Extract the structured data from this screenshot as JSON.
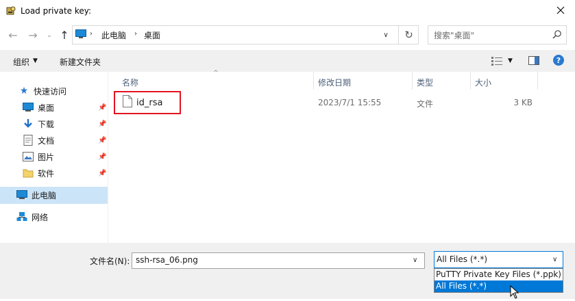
{
  "window": {
    "title": "Load private key:"
  },
  "address": {
    "path": [
      "此电脑",
      "桌面"
    ]
  },
  "search": {
    "placeholder": "搜索\"桌面\""
  },
  "toolbar": {
    "organize_label": "组织",
    "new_folder_label": "新建文件夹"
  },
  "sidebar": {
    "quick_access": "快速访问",
    "pinned": [
      {
        "label": "桌面",
        "icon": "desktop-icon"
      },
      {
        "label": "下载",
        "icon": "download-icon"
      },
      {
        "label": "文档",
        "icon": "document-icon"
      },
      {
        "label": "图片",
        "icon": "pictures-icon"
      },
      {
        "label": "软件",
        "icon": "folder-icon"
      }
    ],
    "this_pc": "此电脑",
    "network": "网络"
  },
  "columns": {
    "name": "名称",
    "modified": "修改日期",
    "type": "类型",
    "size": "大小"
  },
  "files": [
    {
      "name": "id_rsa",
      "modified": "2023/7/1 15:55",
      "type": "文件",
      "size": "3 KB"
    }
  ],
  "bottom": {
    "filename_label": "文件名(N):",
    "filename_value": "ssh-rsa_06.png",
    "filter_selected": "All Files (*.*)",
    "filter_options": [
      "PuTTY Private Key Files (*.ppk)",
      "All Files (*.*)"
    ]
  },
  "colors": {
    "accent": "#0078d7",
    "selection": "#cce4f7",
    "highlight_box": "#e3131f"
  }
}
